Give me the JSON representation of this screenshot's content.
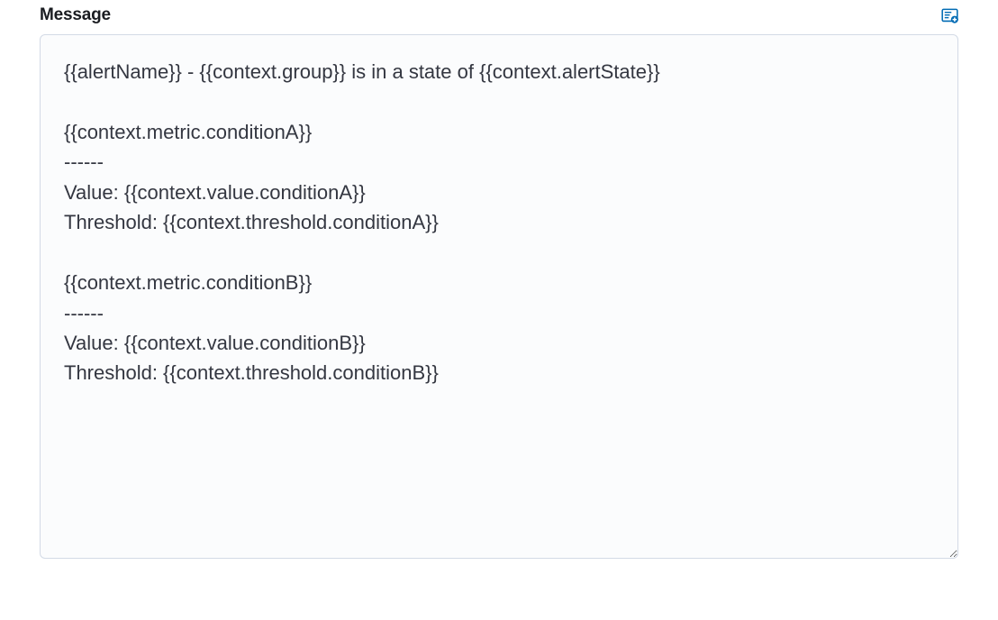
{
  "field": {
    "label": "Message",
    "value": "{{alertName}} - {{context.group}} is in a state of {{context.alertState}}\n\n{{context.metric.conditionA}}\n------\nValue: {{context.value.conditionA}}\nThreshold: {{context.threshold.conditionA}}\n\n{{context.metric.conditionB}}\n------\nValue: {{context.value.conditionB}}\nThreshold: {{context.threshold.conditionB}}"
  },
  "icons": {
    "addVariable": "add-variable-icon"
  }
}
